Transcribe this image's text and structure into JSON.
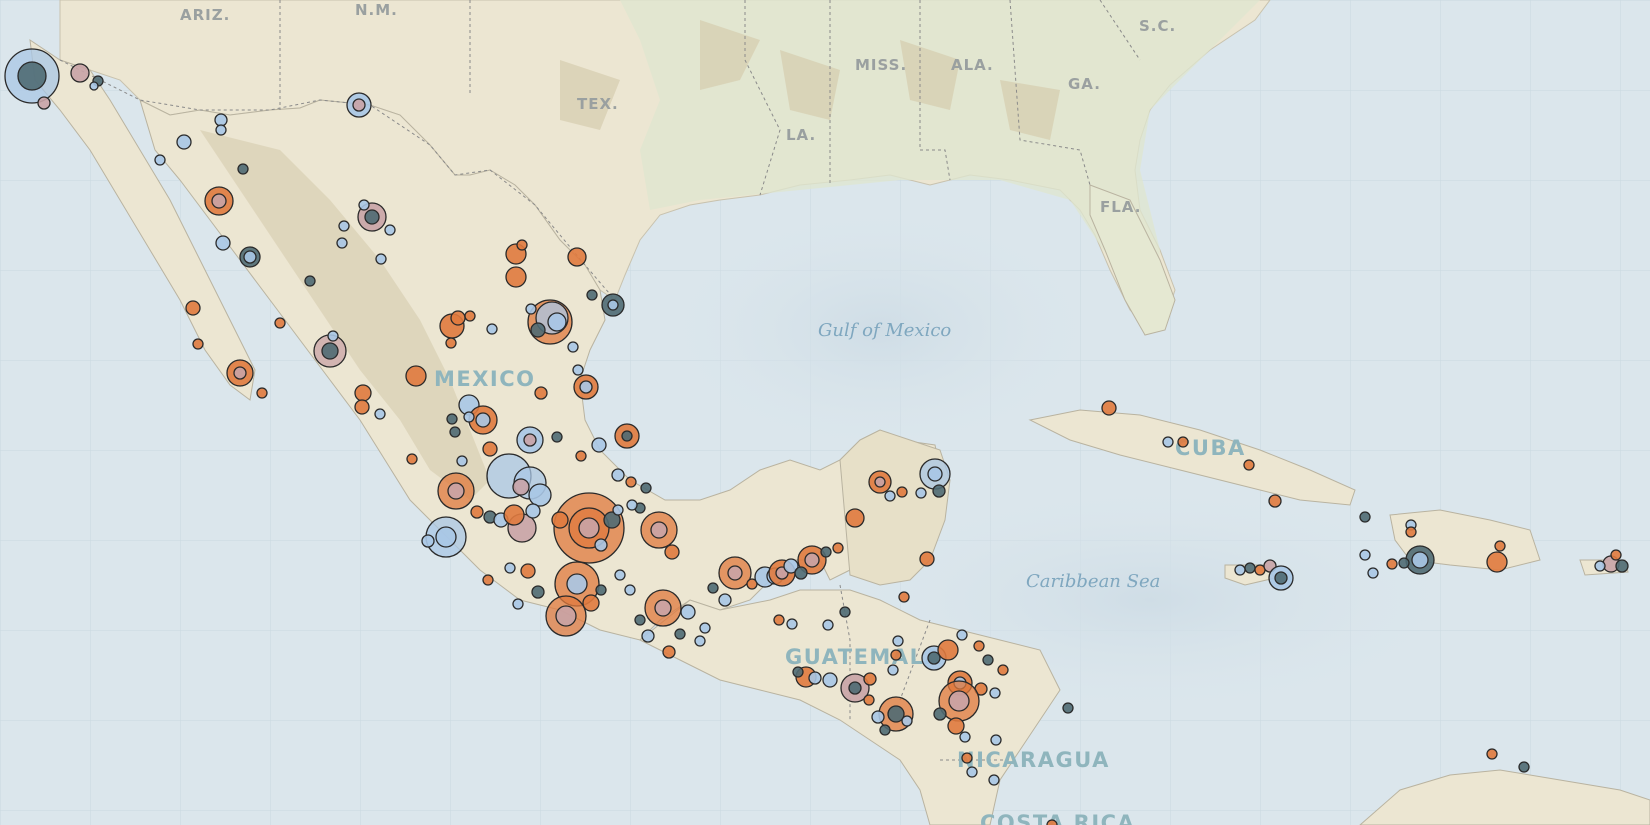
{
  "labels": {
    "states": {
      "ariz": "ARIZ.",
      "nm": "N.M.",
      "tex": "TEX.",
      "miss": "MISS.",
      "ala": "ALA.",
      "ga": "GA.",
      "sc": "S.C.",
      "la": "LA.",
      "fla": "FLA."
    },
    "countries": {
      "mexico": "MEXICO",
      "cuba": "CUBA",
      "guatemala": "GUATEMALA",
      "nicaragua": "NICARAGUA",
      "costa_rica": "COSTA RICA"
    },
    "water": {
      "gulf": "Gulf of Mexico",
      "caribbean": "Caribbean Sea"
    }
  },
  "colors": {
    "ocean": "#dbe6ec",
    "land": "#ece6d2",
    "land_dark": "#dcd2b8",
    "land_green": "#dfe6cf",
    "border": "#8a8a8a",
    "orange_event": "#e07a3e",
    "blue_event": "#a9c7e6",
    "pink_event": "#c9a3a6",
    "dark_event": "#4f6a73",
    "stroke": "#2a2a2a"
  },
  "legend_kinds": [
    "orange-event",
    "blue-event",
    "pink-event",
    "dark-event"
  ]
}
